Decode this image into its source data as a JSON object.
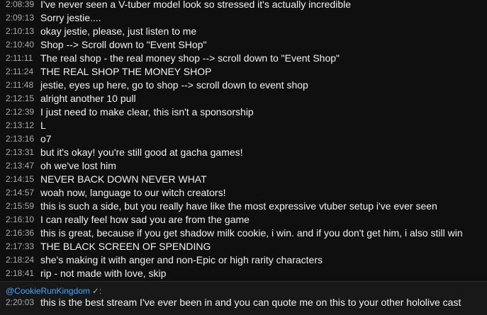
{
  "chat": {
    "messages": [
      {
        "time": "2:08:39",
        "text": "I've never seen a V-tuber model look so stressed it's actually incredible"
      },
      {
        "time": "2:09:13",
        "text": "Sorry jestie...."
      },
      {
        "time": "2:10:13",
        "text": "okay jestie, please, just listen to me"
      },
      {
        "time": "2:10:40",
        "text": "Shop --> Scroll down to \"Event SHop\""
      },
      {
        "time": "2:11:11",
        "text": "The real shop - the real money shop --> scroll down to \"Event Shop\""
      },
      {
        "time": "2:11:24",
        "text": "THE REAL SHOP THE MONEY SHOP"
      },
      {
        "time": "2:11:48",
        "text": "jestie, eyes up here, go to shop --> scroll down to event shop"
      },
      {
        "time": "2:12:15",
        "text": "alright another 10 pull"
      },
      {
        "time": "2:12:39",
        "text": "I just need to make clear, this isn't a sponsorship"
      },
      {
        "time": "2:13:12",
        "text": "L"
      },
      {
        "time": "2:13:16",
        "text": "o7"
      },
      {
        "time": "2:13:31",
        "text": "but it's okay! you're still good at gacha games!"
      },
      {
        "time": "2:13:47",
        "text": "oh we've lost him"
      },
      {
        "time": "2:14:15",
        "text": "NEVER BACK DOWN NEVER WHAT"
      },
      {
        "time": "2:14:57",
        "text": "woah now, language to our witch creators!"
      },
      {
        "time": "2:15:59",
        "text": "this is such a side, but you really have like the most expressive vtuber setup i've ever seen"
      },
      {
        "time": "2:16:10",
        "text": "I can really feel how sad you are from the game"
      },
      {
        "time": "2:16:36",
        "text": "this is great, because if you get shadow milk cookie, i win. and if you don't get him, i also still win"
      },
      {
        "time": "2:17:33",
        "text": "THE BLACK SCREEN OF SPENDING"
      },
      {
        "time": "2:18:24",
        "text": "she's making it with anger and non-Epic or high rarity characters"
      },
      {
        "time": "2:18:41",
        "text": "rip - not made with love, skip"
      }
    ]
  },
  "pinned": {
    "author": "@CookieRunKingdom",
    "verified_mark": "✓:",
    "time": "2:20:03",
    "text": "this is the best stream I've ever been in and you can quote me on this to your other hololive cast"
  },
  "colors": {
    "background": "#0f0f0f",
    "timestamp": "#aaaaaa",
    "text": "#f1f1f1",
    "author": "#3ea6ff",
    "pinned_background": "#181818"
  }
}
